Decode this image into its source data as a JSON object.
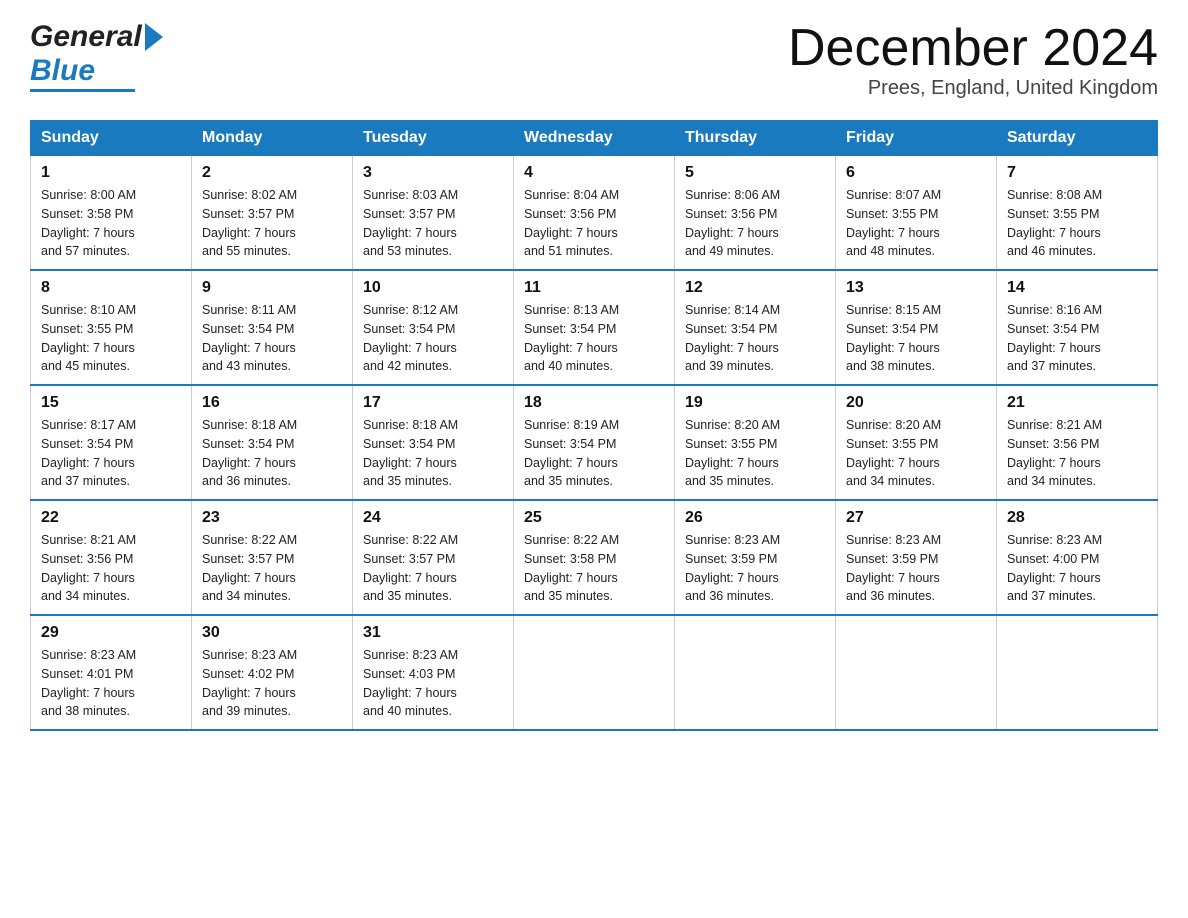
{
  "header": {
    "logo_general": "General",
    "logo_blue": "Blue",
    "month_title": "December 2024",
    "location": "Prees, England, United Kingdom"
  },
  "days_of_week": [
    "Sunday",
    "Monday",
    "Tuesday",
    "Wednesday",
    "Thursday",
    "Friday",
    "Saturday"
  ],
  "weeks": [
    [
      {
        "day": "1",
        "info": "Sunrise: 8:00 AM\nSunset: 3:58 PM\nDaylight: 7 hours\nand 57 minutes."
      },
      {
        "day": "2",
        "info": "Sunrise: 8:02 AM\nSunset: 3:57 PM\nDaylight: 7 hours\nand 55 minutes."
      },
      {
        "day": "3",
        "info": "Sunrise: 8:03 AM\nSunset: 3:57 PM\nDaylight: 7 hours\nand 53 minutes."
      },
      {
        "day": "4",
        "info": "Sunrise: 8:04 AM\nSunset: 3:56 PM\nDaylight: 7 hours\nand 51 minutes."
      },
      {
        "day": "5",
        "info": "Sunrise: 8:06 AM\nSunset: 3:56 PM\nDaylight: 7 hours\nand 49 minutes."
      },
      {
        "day": "6",
        "info": "Sunrise: 8:07 AM\nSunset: 3:55 PM\nDaylight: 7 hours\nand 48 minutes."
      },
      {
        "day": "7",
        "info": "Sunrise: 8:08 AM\nSunset: 3:55 PM\nDaylight: 7 hours\nand 46 minutes."
      }
    ],
    [
      {
        "day": "8",
        "info": "Sunrise: 8:10 AM\nSunset: 3:55 PM\nDaylight: 7 hours\nand 45 minutes."
      },
      {
        "day": "9",
        "info": "Sunrise: 8:11 AM\nSunset: 3:54 PM\nDaylight: 7 hours\nand 43 minutes."
      },
      {
        "day": "10",
        "info": "Sunrise: 8:12 AM\nSunset: 3:54 PM\nDaylight: 7 hours\nand 42 minutes."
      },
      {
        "day": "11",
        "info": "Sunrise: 8:13 AM\nSunset: 3:54 PM\nDaylight: 7 hours\nand 40 minutes."
      },
      {
        "day": "12",
        "info": "Sunrise: 8:14 AM\nSunset: 3:54 PM\nDaylight: 7 hours\nand 39 minutes."
      },
      {
        "day": "13",
        "info": "Sunrise: 8:15 AM\nSunset: 3:54 PM\nDaylight: 7 hours\nand 38 minutes."
      },
      {
        "day": "14",
        "info": "Sunrise: 8:16 AM\nSunset: 3:54 PM\nDaylight: 7 hours\nand 37 minutes."
      }
    ],
    [
      {
        "day": "15",
        "info": "Sunrise: 8:17 AM\nSunset: 3:54 PM\nDaylight: 7 hours\nand 37 minutes."
      },
      {
        "day": "16",
        "info": "Sunrise: 8:18 AM\nSunset: 3:54 PM\nDaylight: 7 hours\nand 36 minutes."
      },
      {
        "day": "17",
        "info": "Sunrise: 8:18 AM\nSunset: 3:54 PM\nDaylight: 7 hours\nand 35 minutes."
      },
      {
        "day": "18",
        "info": "Sunrise: 8:19 AM\nSunset: 3:54 PM\nDaylight: 7 hours\nand 35 minutes."
      },
      {
        "day": "19",
        "info": "Sunrise: 8:20 AM\nSunset: 3:55 PM\nDaylight: 7 hours\nand 35 minutes."
      },
      {
        "day": "20",
        "info": "Sunrise: 8:20 AM\nSunset: 3:55 PM\nDaylight: 7 hours\nand 34 minutes."
      },
      {
        "day": "21",
        "info": "Sunrise: 8:21 AM\nSunset: 3:56 PM\nDaylight: 7 hours\nand 34 minutes."
      }
    ],
    [
      {
        "day": "22",
        "info": "Sunrise: 8:21 AM\nSunset: 3:56 PM\nDaylight: 7 hours\nand 34 minutes."
      },
      {
        "day": "23",
        "info": "Sunrise: 8:22 AM\nSunset: 3:57 PM\nDaylight: 7 hours\nand 34 minutes."
      },
      {
        "day": "24",
        "info": "Sunrise: 8:22 AM\nSunset: 3:57 PM\nDaylight: 7 hours\nand 35 minutes."
      },
      {
        "day": "25",
        "info": "Sunrise: 8:22 AM\nSunset: 3:58 PM\nDaylight: 7 hours\nand 35 minutes."
      },
      {
        "day": "26",
        "info": "Sunrise: 8:23 AM\nSunset: 3:59 PM\nDaylight: 7 hours\nand 36 minutes."
      },
      {
        "day": "27",
        "info": "Sunrise: 8:23 AM\nSunset: 3:59 PM\nDaylight: 7 hours\nand 36 minutes."
      },
      {
        "day": "28",
        "info": "Sunrise: 8:23 AM\nSunset: 4:00 PM\nDaylight: 7 hours\nand 37 minutes."
      }
    ],
    [
      {
        "day": "29",
        "info": "Sunrise: 8:23 AM\nSunset: 4:01 PM\nDaylight: 7 hours\nand 38 minutes."
      },
      {
        "day": "30",
        "info": "Sunrise: 8:23 AM\nSunset: 4:02 PM\nDaylight: 7 hours\nand 39 minutes."
      },
      {
        "day": "31",
        "info": "Sunrise: 8:23 AM\nSunset: 4:03 PM\nDaylight: 7 hours\nand 40 minutes."
      },
      {
        "day": "",
        "info": ""
      },
      {
        "day": "",
        "info": ""
      },
      {
        "day": "",
        "info": ""
      },
      {
        "day": "",
        "info": ""
      }
    ]
  ]
}
